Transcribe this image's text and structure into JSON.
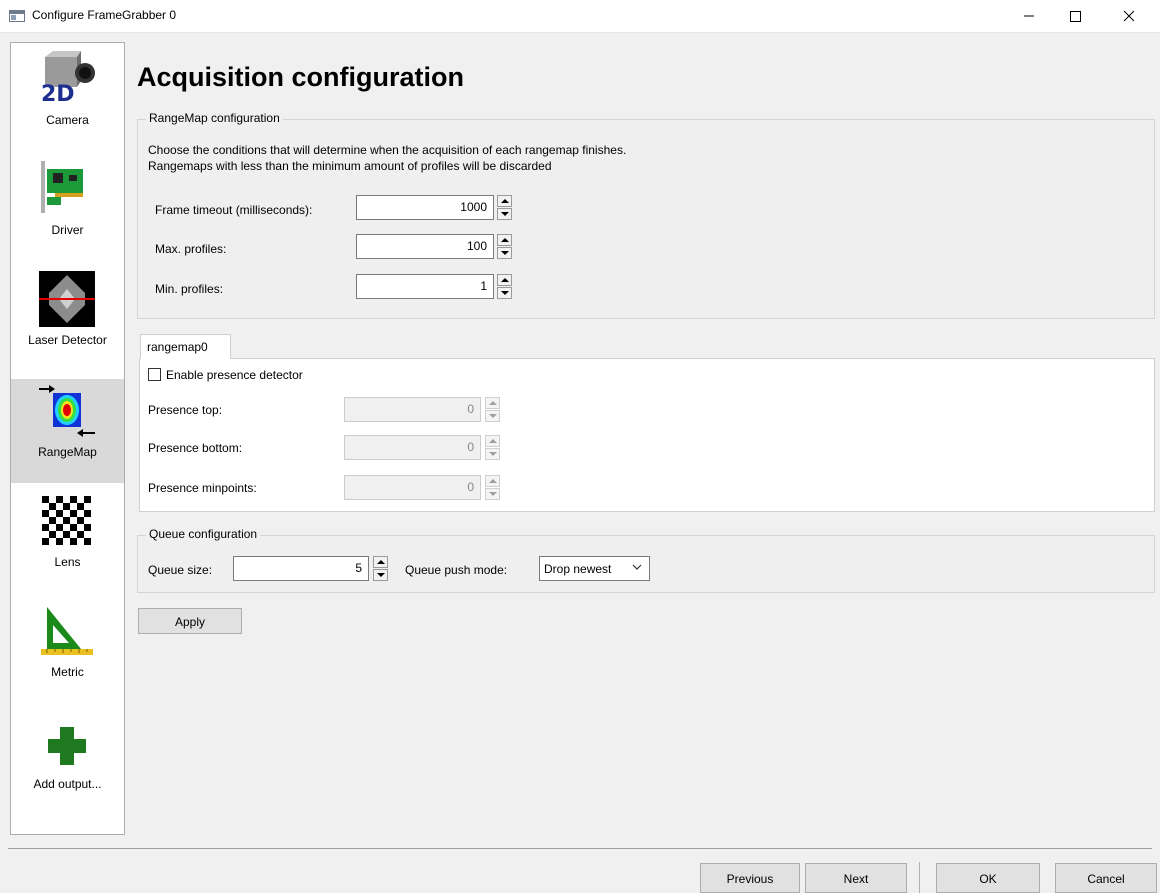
{
  "window": {
    "title": "Configure FrameGrabber 0"
  },
  "sidebar": {
    "items": [
      {
        "label": "Camera",
        "icon": "camera-2d-icon"
      },
      {
        "label": "Driver",
        "icon": "circuit-board-icon"
      },
      {
        "label": "Laser Detector",
        "icon": "laser-detector-icon"
      },
      {
        "label": "RangeMap",
        "icon": "rangemap-icon",
        "selected": true
      },
      {
        "label": "Lens",
        "icon": "checkerboard-icon"
      },
      {
        "label": "Metric",
        "icon": "set-square-ruler-icon"
      },
      {
        "label": "Add output...",
        "icon": "green-plus-icon"
      }
    ]
  },
  "main": {
    "title": "Acquisition configuration",
    "rangemap_group": {
      "title": "RangeMap configuration",
      "desc_line1": "Choose the conditions that will determine when the acquisition of each rangemap finishes.",
      "desc_line2": "Rangemaps with less than the minimum amount of profiles will be discarded",
      "frame_timeout_label": "Frame timeout (milliseconds):",
      "frame_timeout_value": "1000",
      "max_profiles_label": "Max. profiles:",
      "max_profiles_value": "100",
      "min_profiles_label": "Min. profiles:",
      "min_profiles_value": "1"
    },
    "tab": {
      "label": "rangemap0",
      "enable_presence_label": "Enable presence detector",
      "enable_presence_checked": false,
      "presence_top_label": "Presence top:",
      "presence_top_value": "0",
      "presence_bottom_label": "Presence bottom:",
      "presence_bottom_value": "0",
      "presence_minpoints_label": "Presence minpoints:",
      "presence_minpoints_value": "0"
    },
    "queue_group": {
      "title": "Queue configuration",
      "queue_size_label": "Queue size:",
      "queue_size_value": "5",
      "push_mode_label": "Queue push mode:",
      "push_mode_value": "Drop newest"
    },
    "apply_label": "Apply"
  },
  "footer": {
    "previous_label": "Previous",
    "next_label": "Next",
    "ok_label": "OK",
    "cancel_label": "Cancel"
  },
  "colors": {
    "window_bg": "#f0f0f0",
    "selected_nav_bg": "#d9d9d9",
    "laser_red": "#e00000",
    "metric_green": "#1a8a1a",
    "plus_green": "#1f7a1f"
  }
}
